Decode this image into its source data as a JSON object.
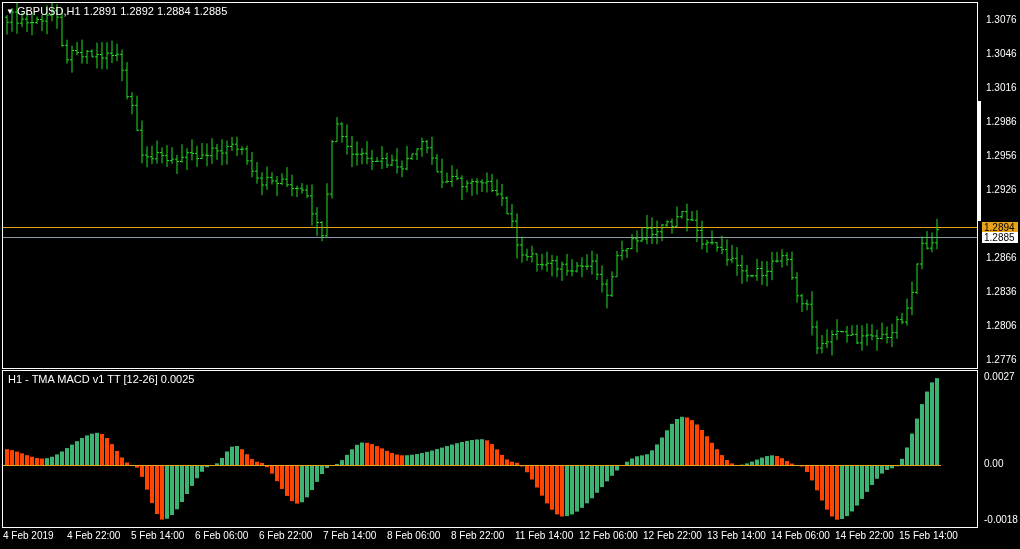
{
  "chart_header": {
    "menu_glyph": "▼",
    "title": "GBPUSD,H1",
    "ohlc": "1.2891 1.2892 1.2884 1.2885"
  },
  "price_axis": {
    "ticks": [
      "1.3076",
      "1.3046",
      "1.3016",
      "1.2986",
      "1.2956",
      "1.2926",
      "1.2866",
      "1.2836",
      "1.2806",
      "1.2776"
    ],
    "price_lines": [
      {
        "kind": "bid",
        "label": "1.2894"
      },
      {
        "kind": "last",
        "label": "1.2885"
      }
    ]
  },
  "indicator": {
    "title": "H1 - TMA MACD v1 TT [12-26] 0.0025",
    "axis_ticks": [
      "0.0027",
      "0.00",
      "-0.0018"
    ]
  },
  "time_axis": {
    "labels": [
      "4 Feb 2019",
      "4 Feb 22:00",
      "5 Feb 14:00",
      "6 Feb 06:00",
      "6 Feb 22:00",
      "7 Feb 14:00",
      "8 Feb 06:00",
      "8 Feb 22:00",
      "11 Feb 14:00",
      "12 Feb 06:00",
      "12 Feb 22:00",
      "13 Feb 14:00",
      "14 Feb 06:00",
      "14 Feb 22:00",
      "15 Feb 14:00"
    ]
  }
}
